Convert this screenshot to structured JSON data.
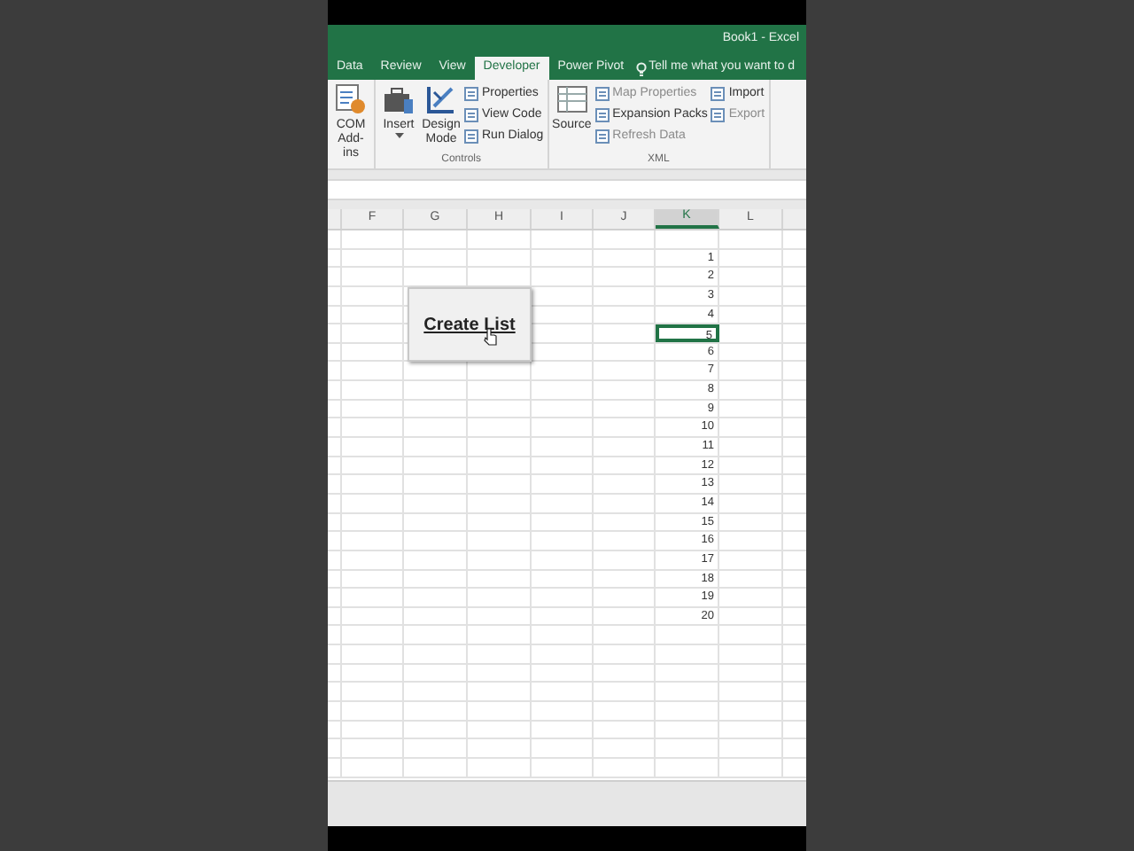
{
  "window": {
    "title": "Book1 - Excel"
  },
  "tabs": [
    {
      "label": "Data",
      "selected": false
    },
    {
      "label": "Review",
      "selected": false
    },
    {
      "label": "View",
      "selected": false
    },
    {
      "label": "Developer",
      "selected": true
    },
    {
      "label": "Power Pivot",
      "selected": false
    }
  ],
  "tell_me": "Tell me what you want to d",
  "ribbon": {
    "groups": [
      {
        "items": [
          {
            "kind": "large",
            "label": "COM Add-ins",
            "disabled": false
          }
        ]
      },
      {
        "label": "Controls",
        "items": [
          {
            "kind": "dropdown",
            "label": "Insert",
            "disabled": false
          },
          {
            "kind": "large",
            "label": "Design Mode",
            "disabled": false
          },
          {
            "kind": "small",
            "label": "Properties",
            "disabled": false
          },
          {
            "kind": "small",
            "label": "View Code",
            "disabled": false
          },
          {
            "kind": "small",
            "label": "Run Dialog",
            "disabled": false
          }
        ]
      },
      {
        "label": "XML",
        "items": [
          {
            "kind": "large",
            "label": "Source",
            "disabled": false
          },
          {
            "kind": "small",
            "label": "Map Properties",
            "disabled": true
          },
          {
            "kind": "small",
            "label": "Expansion Packs",
            "disabled": false
          },
          {
            "kind": "small",
            "label": "Refresh Data",
            "disabled": true
          },
          {
            "kind": "small",
            "label": "Import",
            "disabled": false
          },
          {
            "kind": "small",
            "label": "Export",
            "disabled": true
          }
        ]
      }
    ]
  },
  "columns": [
    {
      "label": "F",
      "selected": false
    },
    {
      "label": "G",
      "selected": false
    },
    {
      "label": "H",
      "selected": false
    },
    {
      "label": "I",
      "selected": false
    },
    {
      "label": "J",
      "selected": false
    },
    {
      "label": "K",
      "selected": true
    },
    {
      "label": "L",
      "selected": false
    }
  ],
  "column_k": [
    {
      "value": "1",
      "selected": false
    },
    {
      "value": "2",
      "selected": false
    },
    {
      "value": "3",
      "selected": false
    },
    {
      "value": "4",
      "selected": false
    },
    {
      "value": "5",
      "selected": true
    },
    {
      "value": "6",
      "selected": false
    },
    {
      "value": "7",
      "selected": false
    },
    {
      "value": "8",
      "selected": false
    },
    {
      "value": "9",
      "selected": false
    },
    {
      "value": "10",
      "selected": false
    },
    {
      "value": "11",
      "selected": false
    },
    {
      "value": "12",
      "selected": false
    },
    {
      "value": "13",
      "selected": false
    },
    {
      "value": "14",
      "selected": false
    },
    {
      "value": "15",
      "selected": false
    },
    {
      "value": "16",
      "selected": false
    },
    {
      "value": "17",
      "selected": false
    },
    {
      "value": "18",
      "selected": false
    },
    {
      "value": "19",
      "selected": false
    },
    {
      "value": "20",
      "selected": false
    }
  ],
  "sheet_button": {
    "label": "Create List"
  }
}
